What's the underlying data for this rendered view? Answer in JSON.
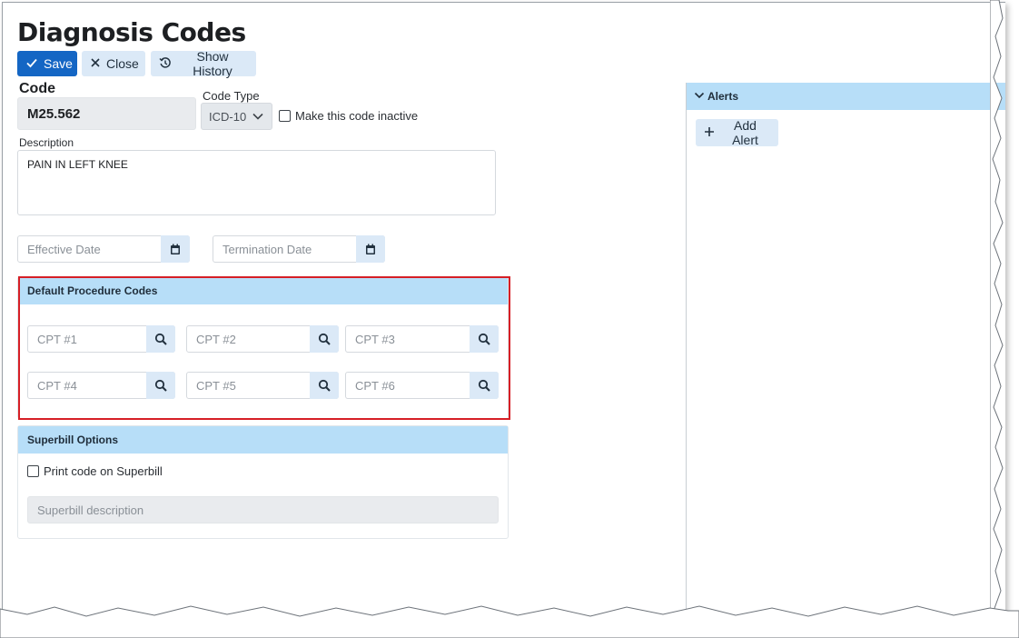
{
  "page": {
    "title": "Diagnosis Codes"
  },
  "toolbar": {
    "save_label": "Save",
    "close_label": "Close",
    "history_label": "Show History"
  },
  "form": {
    "code_label": "Code",
    "code_value": "M25.562",
    "code_type_label": "Code Type",
    "code_type_value": "ICD-10",
    "inactive_label": "Make this code inactive",
    "inactive_checked": false,
    "description_label": "Description",
    "description_value": "PAIN IN LEFT KNEE",
    "effective_date_placeholder": "Effective Date",
    "termination_date_placeholder": "Termination Date"
  },
  "procedure_codes": {
    "title": "Default Procedure Codes",
    "fields": [
      "CPT #1",
      "CPT #2",
      "CPT #3",
      "CPT #4",
      "CPT #5",
      "CPT #6"
    ]
  },
  "superbill": {
    "title": "Superbill Options",
    "print_label": "Print code on Superbill",
    "print_checked": false,
    "description_placeholder": "Superbill description"
  },
  "alerts": {
    "title": "Alerts",
    "add_label": "Add Alert"
  },
  "colors": {
    "primary": "#1466c4",
    "header_bg": "#b7def8",
    "button_light": "#dbe9f7",
    "highlight": "#d61f26"
  }
}
